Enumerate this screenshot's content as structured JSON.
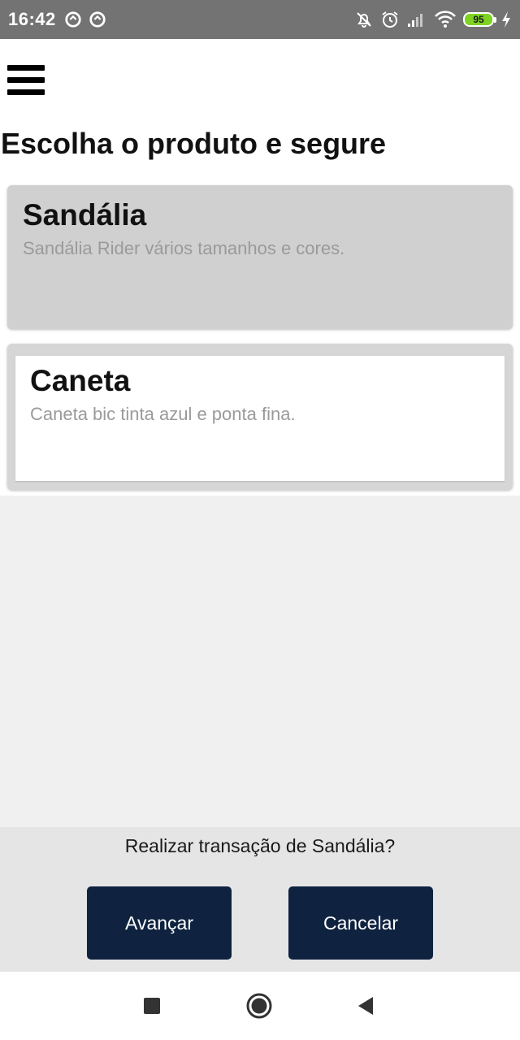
{
  "status_bar": {
    "time": "16:42",
    "battery_level": "95",
    "battery_color": "#7ed321",
    "left_icons": [
      "alert-circle-icon",
      "alert-circle-icon"
    ],
    "right_icons": [
      "notifications-off-icon",
      "alarm-icon",
      "signal-icon",
      "wifi-icon",
      "battery-icon",
      "charging-icon"
    ]
  },
  "header": {
    "menu_icon": "hamburger-menu-icon",
    "title": "Escolha o produto e segure"
  },
  "products": [
    {
      "name": "Sandália",
      "description": "Sandália Rider vários tamanhos e cores.",
      "selected": true
    },
    {
      "name": "Caneta",
      "description": "Caneta bic tinta azul e ponta fina.",
      "selected": false
    }
  ],
  "action_panel": {
    "question": "Realizar transação de Sandália?",
    "advance_label": "Avançar",
    "cancel_label": "Cancelar",
    "button_color": "#0f2340"
  },
  "nav_bar": {
    "icons": [
      "recent-apps-icon",
      "home-icon",
      "back-icon"
    ]
  }
}
